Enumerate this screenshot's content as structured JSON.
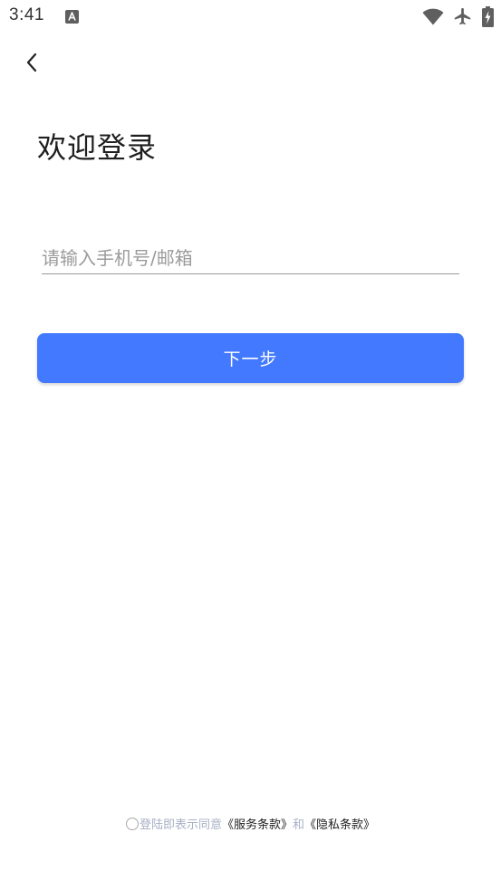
{
  "status_bar": {
    "time": "3:41",
    "notification_icon": "font-a-notification-icon",
    "wifi_icon": "wifi-icon",
    "airplane_icon": "airplane-mode-icon",
    "battery_icon": "battery-charging-icon"
  },
  "nav": {
    "back_icon": "chevron-left-icon"
  },
  "login": {
    "title": "欢迎登录",
    "account_placeholder": "请输入手机号/邮箱",
    "account_value": "",
    "next_label": "下一步"
  },
  "agreement": {
    "checked": false,
    "prefix": "登陆即表示同意",
    "service_terms": "《服务条款》",
    "and": "和",
    "privacy_terms": "《隐私条款》"
  },
  "colors": {
    "primary": "#4279fe",
    "title_text": "#1f1f1f",
    "muted_text": "#a7b0c4",
    "link_text": "#222222"
  }
}
